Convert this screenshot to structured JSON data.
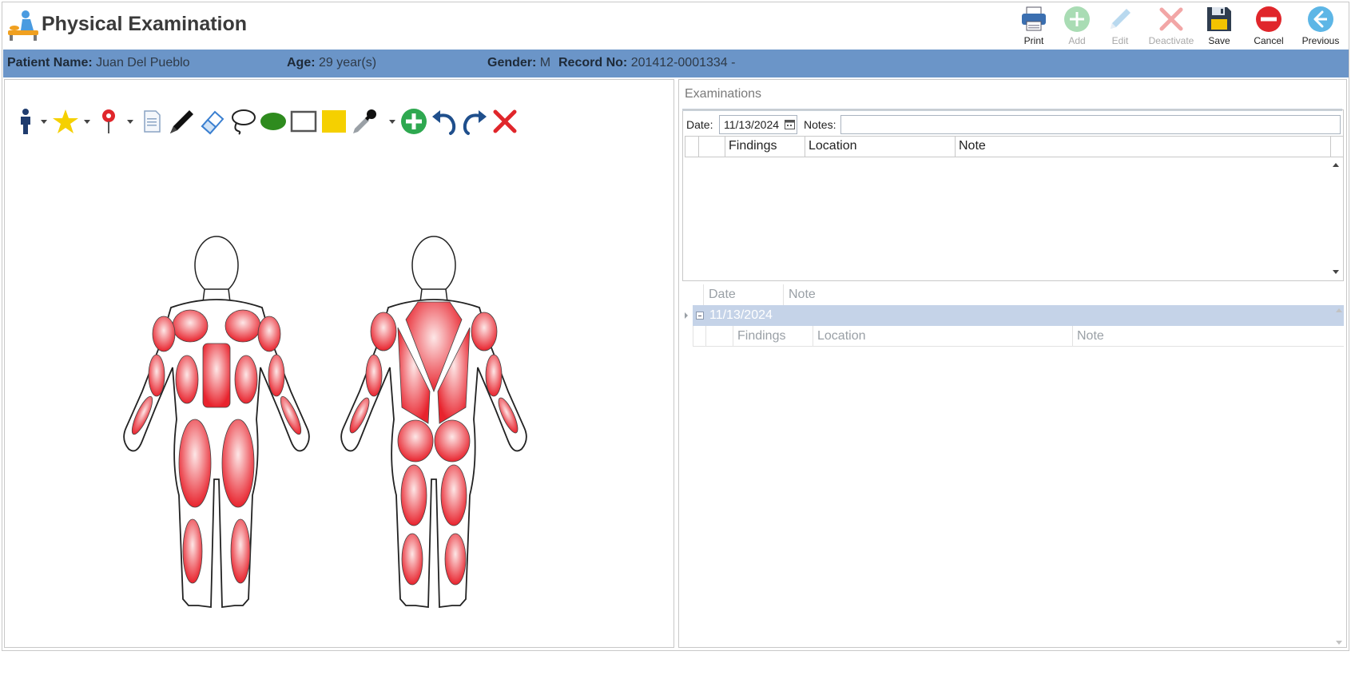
{
  "app": {
    "title": "Physical Examination"
  },
  "toolbar": {
    "print": "Print",
    "add": "Add",
    "edit": "Edit",
    "deactivate": "Deactivate",
    "save": "Save",
    "cancel": "Cancel",
    "previous": "Previous"
  },
  "patient": {
    "name_label": "Patient Name:",
    "name": "Juan Del Pueblo",
    "age_label": "Age:",
    "age": "29 year(s)",
    "gender_label": "Gender:",
    "gender": "M",
    "record_label": "Record No:",
    "record": "201412-0001334 -"
  },
  "drawing_tools": [
    "person-icon",
    "star-icon",
    "map-pin-icon",
    "note-icon",
    "pen-icon",
    "eraser-icon",
    "lasso-icon",
    "ellipse-icon",
    "rectangle-icon",
    "filled-rectangle-icon",
    "eyedropper-icon",
    "add-icon",
    "undo-icon",
    "redo-icon",
    "clear-icon"
  ],
  "colors": {
    "patient_bar": "#6b95c8",
    "selected_row": "#c5d3e8",
    "muscle_red": "#e8232d",
    "star": "#f5d000",
    "ellipse": "#2e8b1e"
  },
  "examinations": {
    "title": "Examinations",
    "date_label": "Date:",
    "date_value": "11/13/2024",
    "notes_label": "Notes:",
    "notes_value": "",
    "columns": [
      "Findings",
      "Location",
      "Note"
    ]
  },
  "history": {
    "columns": [
      "Date",
      "Note"
    ],
    "rows": [
      {
        "date": "11/13/2024"
      }
    ],
    "detail_columns": [
      "Findings",
      "Location",
      "Note"
    ]
  }
}
